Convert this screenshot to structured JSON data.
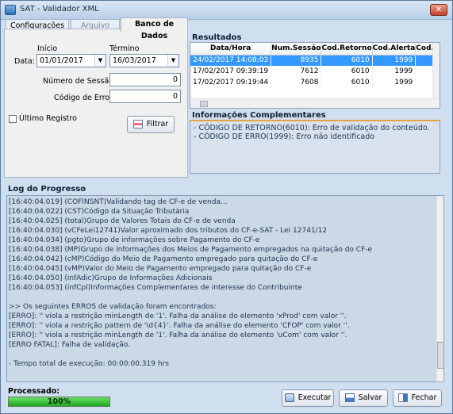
{
  "window": {
    "title": "SAT - Validador XML",
    "close_glyph": "✕"
  },
  "tabs": [
    "Configurações",
    "Arquivo",
    "Banco de Dados"
  ],
  "filters": {
    "inicio_label": "Início",
    "termino_label": "Término",
    "data_label": "Data:",
    "inicio_value": "01/01/2017",
    "termino_value": "16/03/2017",
    "sessao_label": "Número de Sessão:",
    "sessao_value": "0",
    "erro_label": "Código de Erro:",
    "erro_value": "0",
    "ultimo_label": "Último Registro",
    "filtrar_label": "Filtrar"
  },
  "results": {
    "title": "Resultados",
    "columns": [
      "Data/Hora",
      "Num.Sessão",
      "Cod.Retorno",
      "Cod.Alerta",
      "Cod."
    ],
    "rows": [
      [
        "24/02/2017 14:08:03",
        "8935",
        "6010",
        "1999"
      ],
      [
        "17/02/2017 09:39:19",
        "7612",
        "6010",
        "1999"
      ],
      [
        "17/02/2017 09:19:44",
        "7608",
        "6010",
        "1999"
      ]
    ]
  },
  "info": {
    "title": "Informações Complementares",
    "lines": [
      "- CÓDIGO DE RETORNO(6010): Erro de validação do conteúdo.",
      "- CÓDIGO DE ERRO(1999): Erro não identificado"
    ]
  },
  "log": {
    "title": "Log do Progresso",
    "lines": [
      "[16:40:04.019] (COFINSNT)Validando tag de CF-e de venda...",
      "[16:40:04.022] (CST)Código da Situação Tributária",
      "[16:40:04.025] (total)Grupo de Valores Totais do CF-e de venda",
      "[16:40:04.030] (vCFeLei12741)Valor aproximado dos tributos do CF-e-SAT - Lei 12741/12",
      "[16:40:04.034] (pgto)Grupo de informações sobre Pagamento do CF-e",
      "[16:40:04.038] (MP)Grupo de informações dos Meios de Pagamento empregados na quitação do CF-e",
      "[16:40:04.042] (cMP)Código do Meio de Pagamento empregado para quitação do CF-e",
      "[16:40:04.045] (vMP)Valor do Meio de Pagamento empregado para quitação do CF-e",
      "[16:40:04.050] (infAdic)Grupo de Informações Adicionais",
      "[16:40:04.053] (infCpl)Informações Complementares de interesse do Contribuinte",
      "",
      ">> Os seguintes ERROS de validação foram encontrados:",
      "[ERRO]: '' viola a restrição minLength de '1'. Falha da análise do elemento 'xProd' com valor ''.",
      "[ERRO]: '' viola a restrição pattern de '\\d{4}'. Falha da análise do elemento 'CFOP' com valor ''.",
      "[ERRO]: '' viola a restrição minLength de '1'. Falha da análise do elemento 'uCom' com valor ''.",
      "[ERRO FATAL]: Falha de validação.",
      "",
      "- Tempo total de execução: 00:00:00.319 hrs"
    ]
  },
  "footer": {
    "processado_label": "Processado:",
    "progress": "100%",
    "progress_value": 1.0,
    "executar": "Executar",
    "salvar": "Salvar",
    "fechar": "Fechar"
  }
}
